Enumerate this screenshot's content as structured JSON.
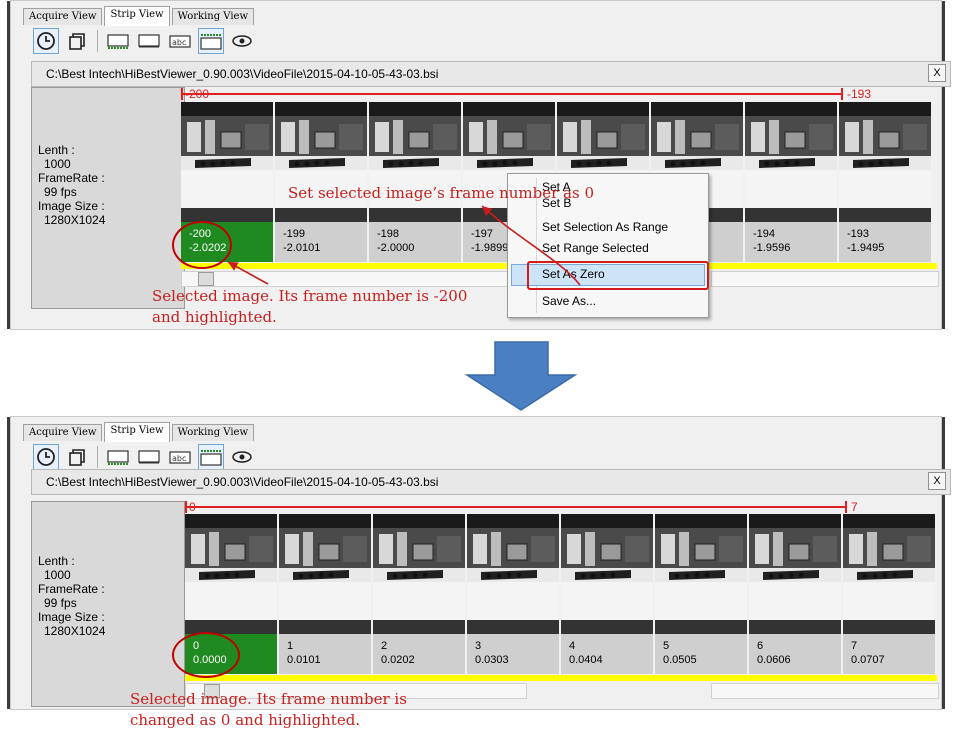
{
  "tabs": [
    "Acquire View",
    "Strip View",
    "Working View"
  ],
  "file_path": "C:\\Best Intech\\HiBestViewer_0.90.003\\VideoFile\\2015-04-10-05-43-03.bsi",
  "close_label": "X",
  "info": {
    "length_label": "Lenth :",
    "length_value": "1000",
    "framerate_label": "FrameRate :",
    "framerate_value": "99 fps",
    "imagesize_label": "Image Size :",
    "imagesize_value": "1280X1024"
  },
  "before": {
    "range_start": "-200",
    "range_end": "-193",
    "frames": [
      {
        "num": "-200",
        "time": "-2.0202"
      },
      {
        "num": "-199",
        "time": "-2.0101"
      },
      {
        "num": "-198",
        "time": "-2.0000"
      },
      {
        "num": "-197",
        "time": "-1.9899"
      },
      {
        "num": "",
        "time": ""
      },
      {
        "num": "",
        "time": ""
      },
      {
        "num": "-194",
        "time": "-1.9596"
      },
      {
        "num": "-193",
        "time": "-1.9495"
      }
    ],
    "context_menu": [
      "Set A",
      "Set B",
      "Set Selection As Range",
      "Set Range Selected",
      "Set As Zero",
      "Save As..."
    ],
    "annotation_menu": "Set selected image’s frame number as 0",
    "annotation_selected_line1": "Selected image. Its frame number is -200",
    "annotation_selected_line2": "and highlighted."
  },
  "after": {
    "range_start": "0",
    "range_end": "7",
    "frames": [
      {
        "num": "0",
        "time": "0.0000"
      },
      {
        "num": "1",
        "time": "0.0101"
      },
      {
        "num": "2",
        "time": "0.0202"
      },
      {
        "num": "3",
        "time": "0.0303"
      },
      {
        "num": "4",
        "time": "0.0404"
      },
      {
        "num": "5",
        "time": "0.0505"
      },
      {
        "num": "6",
        "time": "0.0606"
      },
      {
        "num": "7",
        "time": "0.0707"
      }
    ],
    "annotation_selected_line1": "Selected image. Its frame number is",
    "annotation_selected_line2": "changed as 0 and highlighted."
  },
  "icons": [
    "clock-icon",
    "copy-icon",
    "strip-icon",
    "strip-flat-icon",
    "abc-icon",
    "ruler-icon",
    "eye-icon"
  ],
  "colors": {
    "selected_frame": "#1f8a1f",
    "range_bar": "#e02020",
    "annotation": "#c81e1e",
    "arrow": "#4a7fc1",
    "yellow_bar": "#ffff00"
  }
}
